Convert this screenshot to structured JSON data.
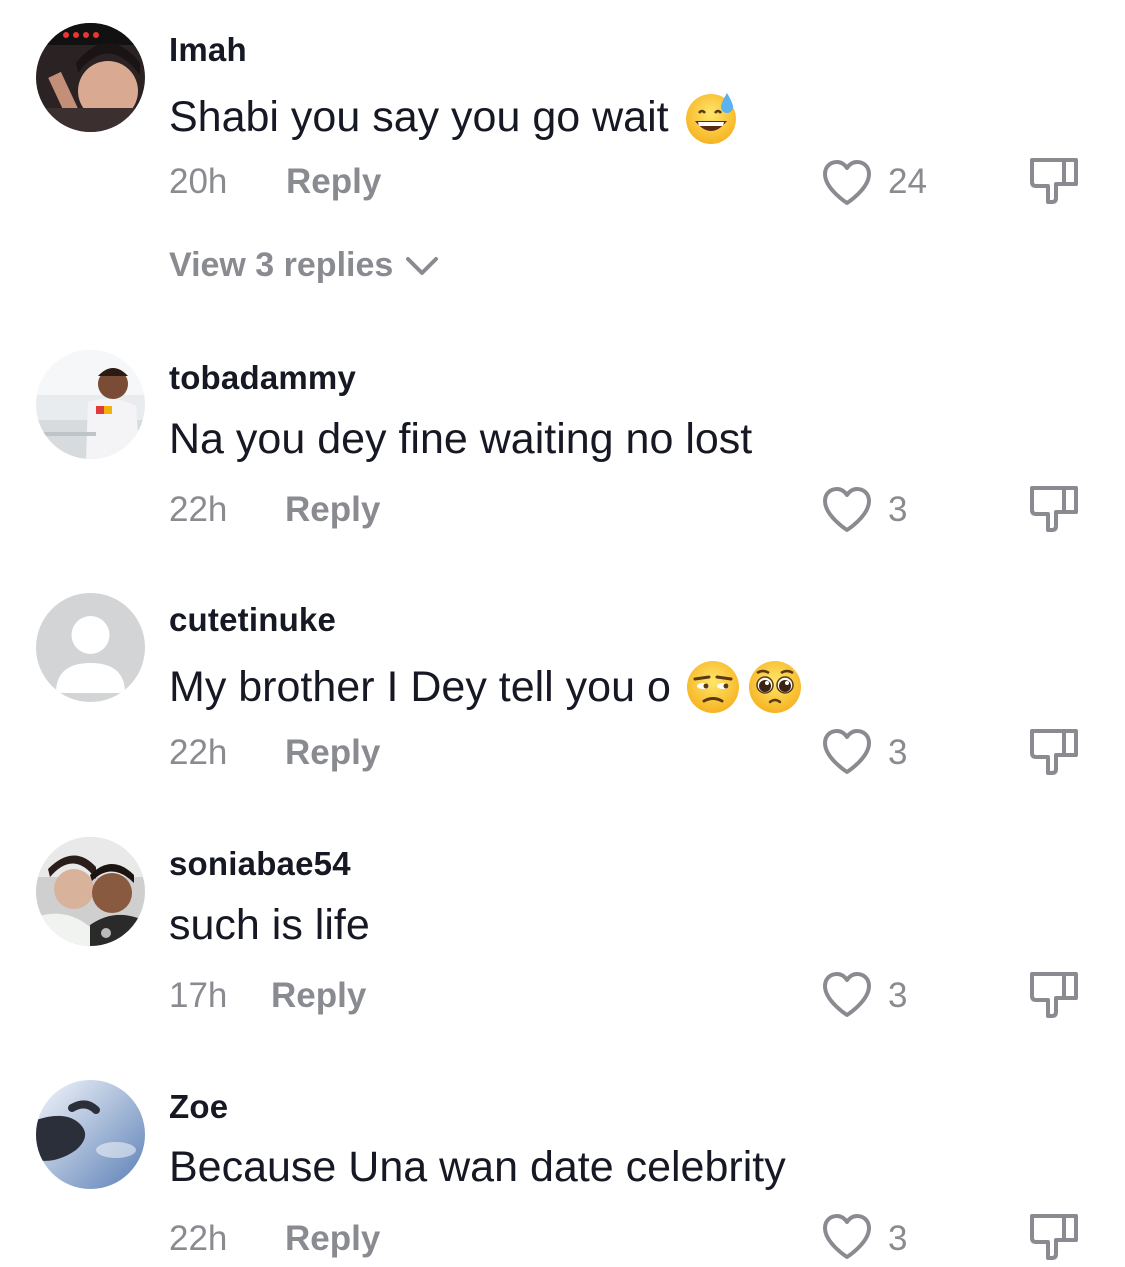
{
  "comments": [
    {
      "username": "Imah",
      "text": "Shabi you say you go wait",
      "emojis": [
        "grinning-sweat-emoji"
      ],
      "time": "20h",
      "reply_label": "Reply",
      "likes": "24",
      "view_replies": "View 3 replies"
    },
    {
      "username": "tobadammy",
      "text": "Na you dey fine waiting no lost",
      "emojis": [],
      "time": "22h",
      "reply_label": "Reply",
      "likes": "3"
    },
    {
      "username": "cutetinuke",
      "text": "My brother I Dey tell you o",
      "emojis": [
        "unamused-face-emoji",
        "pleading-face-emoji"
      ],
      "time": "22h",
      "reply_label": "Reply",
      "likes": "3"
    },
    {
      "username": "soniabae54",
      "text": "such is life",
      "emojis": [],
      "time": "17h",
      "reply_label": "Reply",
      "likes": "3"
    },
    {
      "username": "Zoe",
      "text": "Because Una wan date celebrity",
      "emojis": [],
      "time": "22h",
      "reply_label": "Reply",
      "likes": "3"
    }
  ],
  "icons": {
    "like": "heart-outline-icon",
    "dislike": "thumbs-down-icon",
    "expand": "chevron-down-icon"
  },
  "colors": {
    "primary_text": "#161823",
    "secondary_text": "#8a8b91"
  }
}
